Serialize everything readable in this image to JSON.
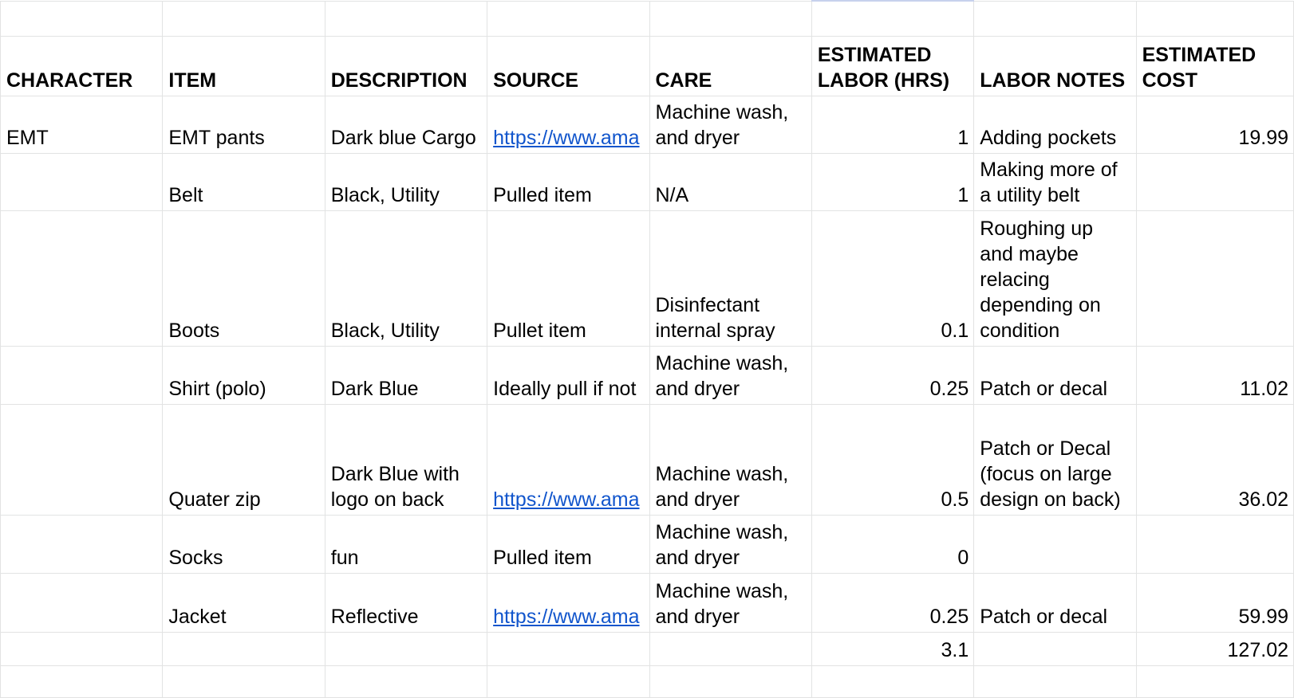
{
  "sheet": {
    "headers": {
      "character": "CHARACTER",
      "item": "ITEM",
      "description": "DESCRIPTION",
      "source": "SOURCE",
      "care": "CARE",
      "labor_hrs": "ESTIMATED LABOR (HRS)",
      "labor_notes": "LABOR NOTES",
      "cost": "ESTIMATED COST"
    },
    "rows": [
      {
        "character": "EMT",
        "item": "EMT pants",
        "description": "Dark blue Cargo",
        "source": "https://www.ama",
        "care": "Machine wash, and dryer",
        "labor_hrs": "1",
        "labor_notes": "Adding pockets",
        "cost": "19.99"
      },
      {
        "character": "",
        "item": "Belt",
        "description": "Black, Utility",
        "source": "Pulled item",
        "care": "N/A",
        "labor_hrs": "1",
        "labor_notes": "Making more of a utility belt",
        "cost": ""
      },
      {
        "character": "",
        "item": "Boots",
        "description": "Black, Utility",
        "source": "Pullet item",
        "care": "Disinfectant internal spray",
        "labor_hrs": "0.1",
        "labor_notes": "Roughing up and maybe relacing depending on condition",
        "cost": ""
      },
      {
        "character": "",
        "item": "Shirt (polo)",
        "description": "Dark Blue",
        "source": "Ideally pull if not",
        "care": "Machine wash, and dryer",
        "labor_hrs": "0.25",
        "labor_notes": "Patch or decal",
        "cost": "11.02"
      },
      {
        "character": "",
        "item": "Quater zip",
        "description": "Dark Blue with logo on back",
        "source": "https://www.ama",
        "care": "Machine wash, and dryer",
        "labor_hrs": "0.5",
        "labor_notes": "Patch or Decal (focus on large design on back)",
        "cost": "36.02"
      },
      {
        "character": "",
        "item": "Socks",
        "description": "fun",
        "source": "Pulled item",
        "care": "Machine wash, and dryer",
        "labor_hrs": "0",
        "labor_notes": "",
        "cost": ""
      },
      {
        "character": "",
        "item": "Jacket",
        "description": "Reflective",
        "source": "https://www.ama",
        "care": "Machine wash, and dryer",
        "labor_hrs": "0.25",
        "labor_notes": "Patch or decal",
        "cost": "59.99"
      }
    ],
    "totals": {
      "labor_hrs": "3.1",
      "cost": "127.02"
    }
  }
}
